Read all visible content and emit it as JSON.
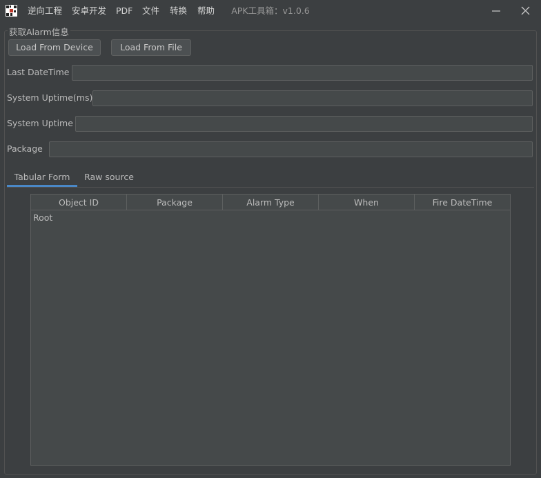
{
  "window": {
    "title": "APK工具箱：v1.0.6",
    "menu": [
      "逆向工程",
      "安卓开发",
      "PDF",
      "文件",
      "转换",
      "帮助"
    ],
    "minimize_icon": "minimize-icon",
    "close_icon": "close-icon"
  },
  "group": {
    "title": "获取Alarm信息",
    "load_from_device": "Load From Device",
    "load_from_file": "Load From File"
  },
  "fields": {
    "last_datetime": {
      "label": "Last DateTime",
      "value": ""
    },
    "system_uptime_ms": {
      "label": "System Uptime(ms)",
      "value": ""
    },
    "system_uptime": {
      "label": "System Uptime",
      "value": ""
    },
    "package": {
      "label": "Package",
      "value": ""
    }
  },
  "tabs": [
    {
      "label": "Tabular Form",
      "active": true
    },
    {
      "label": "Raw source",
      "active": false
    }
  ],
  "table": {
    "columns": [
      "Object ID",
      "Package",
      "Alarm Type",
      "When",
      "Fire DateTime"
    ],
    "root_label": "Root"
  },
  "colors": {
    "background": "#3c3f41",
    "accent": "#4a88c7"
  }
}
